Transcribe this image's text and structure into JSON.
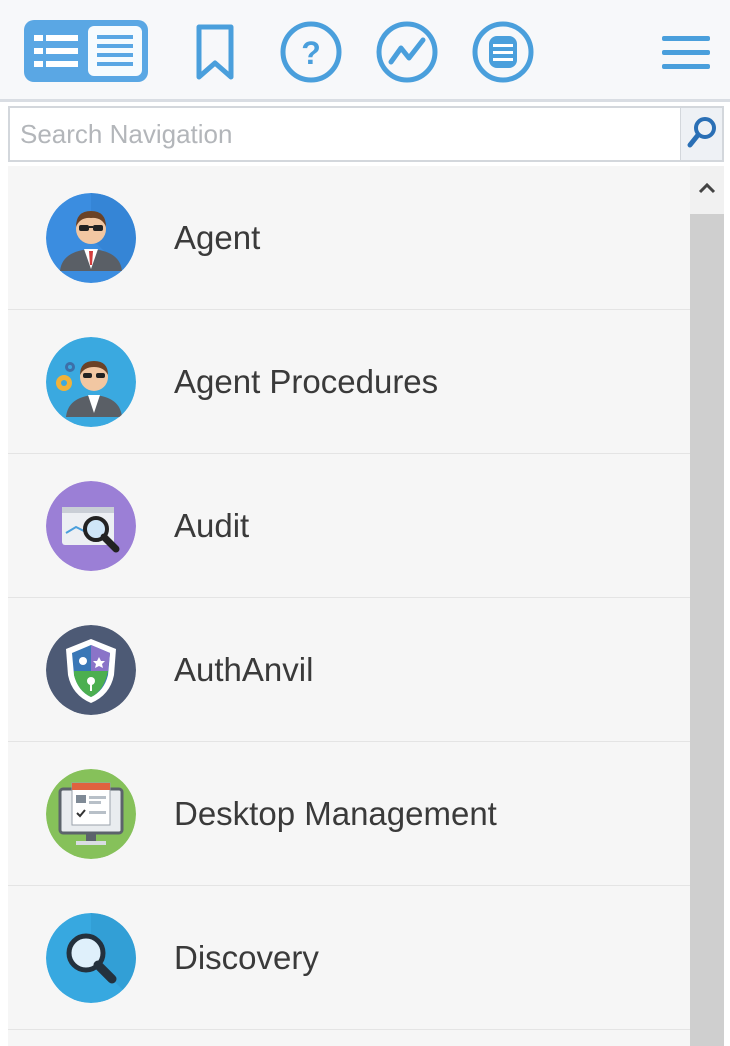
{
  "toolbar": {
    "icons": [
      "navigation-tree-icon",
      "bookmark-icon",
      "help-icon",
      "chart-icon",
      "database-icon",
      "hamburger-menu-icon"
    ],
    "accent_color": "#4a9fdc"
  },
  "search": {
    "placeholder": "Search Navigation",
    "value": "",
    "button_icon": "search-icon"
  },
  "nav": {
    "items": [
      {
        "label": "Agent",
        "icon": "agent-icon",
        "color": "#3b8de0"
      },
      {
        "label": "Agent Procedures",
        "icon": "agent-procedures-icon",
        "color": "#3aa9e0"
      },
      {
        "label": "Audit",
        "icon": "audit-icon",
        "color": "#9b7fd6"
      },
      {
        "label": "AuthAnvil",
        "icon": "authanvil-icon",
        "color": "#4d5a75"
      },
      {
        "label": "Desktop Management",
        "icon": "desktop-management-icon",
        "color": "#86c15a"
      },
      {
        "label": "Discovery",
        "icon": "discovery-icon",
        "color": "#37a8e0"
      }
    ]
  },
  "scrollbar": {
    "up_icon": "chevron-up-icon"
  }
}
